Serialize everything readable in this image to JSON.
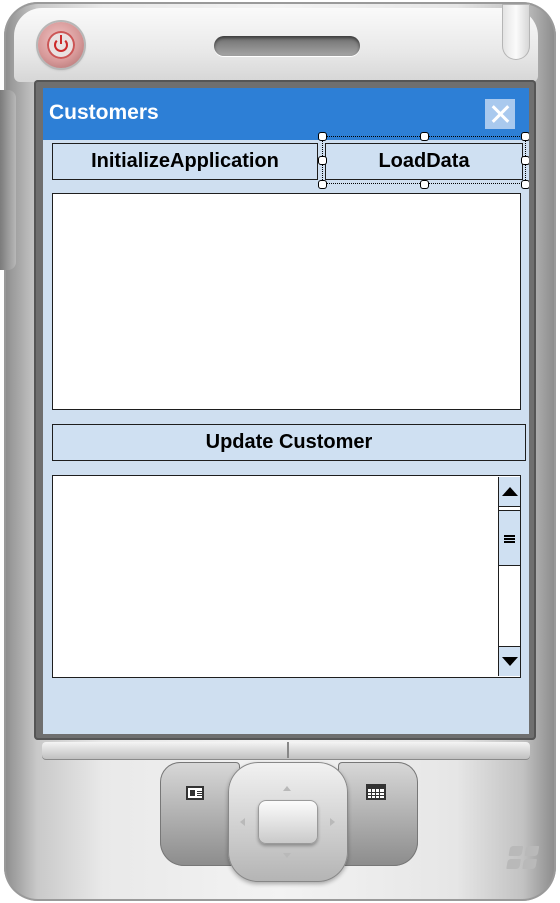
{
  "window": {
    "title": "Customers"
  },
  "buttons": {
    "initialize": "InitializeApplication",
    "load_data": "LoadData",
    "update_customer": "Update Customer"
  },
  "colors": {
    "title_bar": "#2d7fd6",
    "button_fill": "#cfe0f2",
    "screen_background": "#cfdff0"
  },
  "icons": {
    "close": "close-icon",
    "power": "power-icon",
    "contacts": "contacts-icon",
    "calendar": "calendar-icon",
    "windows": "windows-logo-icon",
    "scroll_up": "arrow-up-icon",
    "scroll_down": "arrow-down-icon",
    "scroll_thumb": "grip-icon"
  }
}
